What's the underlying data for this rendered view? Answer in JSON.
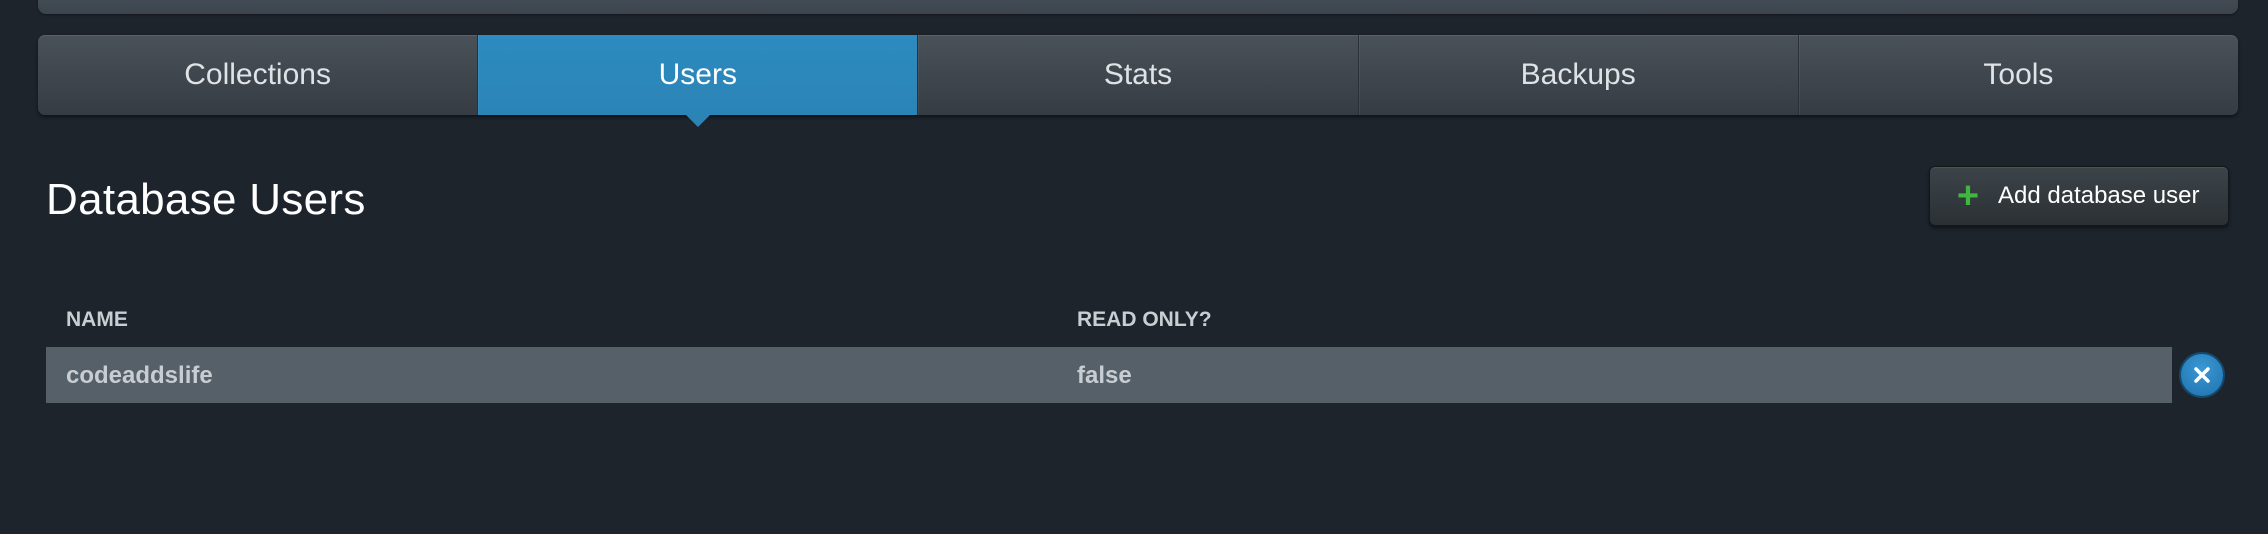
{
  "tabs": [
    {
      "label": "Collections",
      "active": false
    },
    {
      "label": "Users",
      "active": true
    },
    {
      "label": "Stats",
      "active": false
    },
    {
      "label": "Backups",
      "active": false
    },
    {
      "label": "Tools",
      "active": false
    }
  ],
  "page": {
    "title": "Database Users",
    "add_button_label": "Add database user"
  },
  "table": {
    "columns": [
      "NAME",
      "READ ONLY?"
    ],
    "rows": [
      {
        "name": "codeaddslife",
        "read_only": "false"
      }
    ]
  },
  "icons": {
    "add": "plus-icon",
    "delete": "close-icon"
  },
  "colors": {
    "background": "#1e242c",
    "accent": "#2b84b6",
    "plus": "#3db83d",
    "row": "#566069"
  }
}
